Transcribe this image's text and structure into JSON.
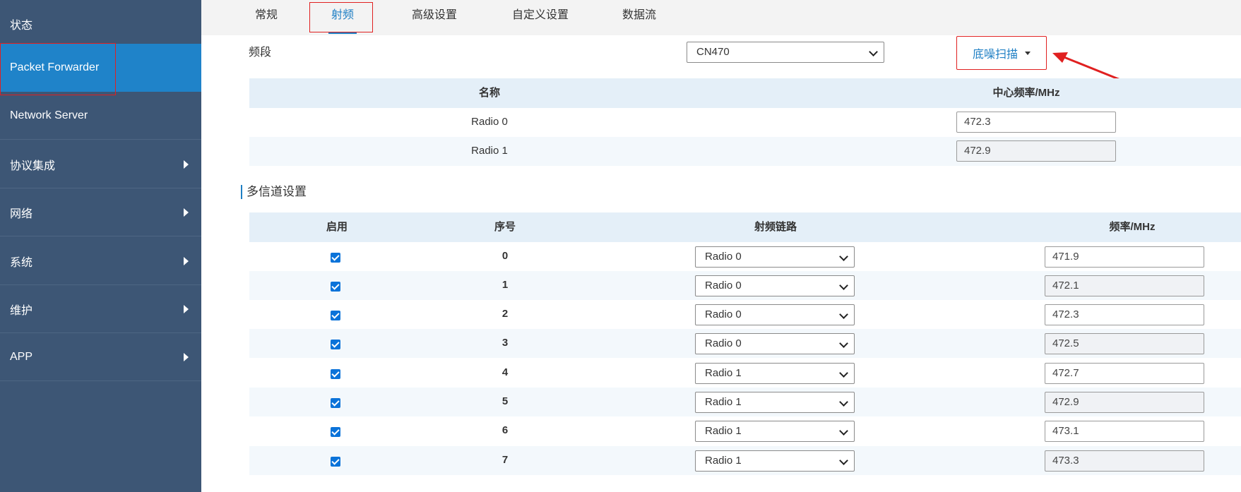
{
  "sidebar": {
    "items": [
      {
        "label": "状态",
        "has_submenu": false,
        "active": false
      },
      {
        "label": "Packet Forwarder",
        "has_submenu": false,
        "active": true
      },
      {
        "label": "Network Server",
        "has_submenu": false,
        "active": false
      },
      {
        "label": "协议集成",
        "has_submenu": true,
        "active": false
      },
      {
        "label": "网络",
        "has_submenu": true,
        "active": false
      },
      {
        "label": "系统",
        "has_submenu": true,
        "active": false
      },
      {
        "label": "维护",
        "has_submenu": true,
        "active": false
      },
      {
        "label": "APP",
        "has_submenu": true,
        "active": false
      }
    ]
  },
  "tabs": [
    {
      "label": "常规",
      "active": false
    },
    {
      "label": "射频",
      "active": true
    },
    {
      "label": "高级设置",
      "active": false
    },
    {
      "label": "自定义设置",
      "active": false
    },
    {
      "label": "数据流",
      "active": false
    }
  ],
  "band": {
    "label": "频段",
    "selected": "CN470",
    "scan_button": "底噪扫描"
  },
  "radio_table": {
    "headers": [
      "名称",
      "中心频率/MHz"
    ],
    "rows": [
      {
        "name": "Radio 0",
        "freq": "472.3"
      },
      {
        "name": "Radio 1",
        "freq": "472.9"
      }
    ]
  },
  "multichannel": {
    "title": "多信道设置",
    "headers": [
      "启用",
      "序号",
      "射频链路",
      "频率/MHz"
    ],
    "rows": [
      {
        "enabled": true,
        "index": "0",
        "radio": "Radio 0",
        "freq": "471.9"
      },
      {
        "enabled": true,
        "index": "1",
        "radio": "Radio 0",
        "freq": "472.1"
      },
      {
        "enabled": true,
        "index": "2",
        "radio": "Radio 0",
        "freq": "472.3"
      },
      {
        "enabled": true,
        "index": "3",
        "radio": "Radio 0",
        "freq": "472.5"
      },
      {
        "enabled": true,
        "index": "4",
        "radio": "Radio 1",
        "freq": "472.7"
      },
      {
        "enabled": true,
        "index": "5",
        "radio": "Radio 1",
        "freq": "472.9"
      },
      {
        "enabled": true,
        "index": "6",
        "radio": "Radio 1",
        "freq": "473.1"
      },
      {
        "enabled": true,
        "index": "7",
        "radio": "Radio 1",
        "freq": "473.3"
      }
    ]
  },
  "colors": {
    "sidebar_bg": "#3d5675",
    "sidebar_active": "#1f83c9",
    "accent": "#1f7fc4",
    "annotation_red": "#e02020",
    "checkbox": "#0b73d9"
  }
}
